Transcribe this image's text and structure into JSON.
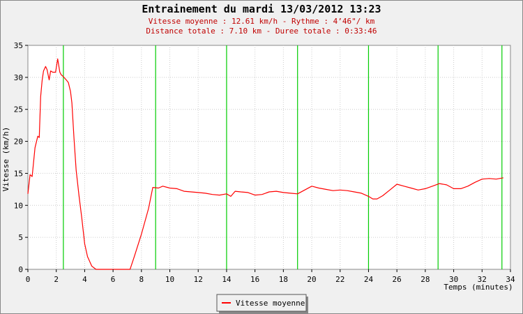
{
  "chart_data": {
    "type": "line",
    "title": "Entrainement du mardi 13/03/2012 13:23",
    "subtitle_lines": [
      "Vitesse moyenne : 12.61 km/h - Rythme : 4’46\"/ km",
      "Distance totale : 7.10 km - Duree totale : 0:33:46"
    ],
    "xlabel": "Temps (minutes)",
    "ylabel": "Vitesse (km/h)",
    "xlim": [
      0,
      34
    ],
    "ylim": [
      0,
      35
    ],
    "x_ticks": [
      0,
      2,
      4,
      6,
      8,
      10,
      12,
      14,
      16,
      18,
      20,
      22,
      24,
      26,
      28,
      30,
      32,
      34
    ],
    "y_ticks": [
      0,
      5,
      10,
      15,
      20,
      25,
      30,
      35
    ],
    "legend_position": "bottom-center",
    "colors": {
      "series": "#ff0000",
      "markers": "#00cc00",
      "title": "#000000",
      "subtitle": "#c00000",
      "plot_bg": "#ffffff",
      "page_bg": "#f0f0f0"
    },
    "km_markers": [
      2.5,
      9.0,
      14.0,
      19.0,
      24.0,
      28.9,
      33.4
    ],
    "series": [
      {
        "name": "Vitesse moyenne",
        "x": [
          0,
          0.15,
          0.3,
          0.5,
          0.7,
          0.8,
          0.9,
          1.0,
          1.1,
          1.25,
          1.35,
          1.5,
          1.6,
          1.75,
          1.95,
          2.1,
          2.25,
          2.35,
          2.5,
          2.7,
          2.85,
          3.0,
          3.1,
          3.25,
          3.4,
          3.6,
          3.8,
          4.0,
          4.2,
          4.5,
          4.8,
          5.0,
          5.2,
          5.4,
          7.2,
          7.5,
          8.0,
          8.5,
          8.8,
          9.2,
          9.5,
          10.0,
          10.5,
          11.0,
          11.5,
          12.0,
          12.5,
          13.0,
          13.5,
          14.0,
          14.3,
          14.6,
          15.0,
          15.5,
          16.0,
          16.5,
          17.0,
          17.5,
          18.0,
          18.5,
          19.0,
          19.5,
          20.0,
          20.5,
          21.0,
          21.5,
          22.0,
          22.5,
          23.0,
          23.5,
          24.0,
          24.3,
          24.6,
          25.0,
          25.5,
          26.0,
          26.5,
          27.0,
          27.5,
          28.0,
          28.5,
          29.0,
          29.5,
          30.0,
          30.5,
          31.0,
          31.5,
          32.0,
          32.5,
          33.0,
          33.5
        ],
        "values": [
          11.8,
          14.8,
          14.5,
          19.0,
          20.8,
          20.6,
          27.0,
          29.5,
          31.0,
          31.7,
          31.2,
          29.6,
          31.0,
          30.8,
          30.8,
          32.9,
          30.8,
          30.4,
          30.1,
          29.6,
          29.2,
          27.8,
          26.0,
          20.5,
          15.5,
          11.5,
          8.0,
          4.0,
          2.0,
          0.5,
          0.0,
          0.0,
          0.0,
          0.0,
          0.0,
          2.0,
          5.5,
          9.5,
          12.8,
          12.7,
          13.0,
          12.7,
          12.6,
          12.2,
          12.1,
          12.0,
          11.9,
          11.7,
          11.6,
          11.8,
          11.4,
          12.2,
          12.1,
          12.0,
          11.6,
          11.7,
          12.1,
          12.2,
          12.0,
          11.9,
          11.8,
          12.4,
          13.0,
          12.7,
          12.5,
          12.3,
          12.4,
          12.3,
          12.1,
          11.9,
          11.4,
          11.0,
          11.0,
          11.5,
          12.4,
          13.3,
          13.0,
          12.7,
          12.4,
          12.6,
          13.0,
          13.4,
          13.2,
          12.6,
          12.6,
          13.0,
          13.6,
          14.1,
          14.2,
          14.1,
          14.3
        ]
      }
    ]
  }
}
